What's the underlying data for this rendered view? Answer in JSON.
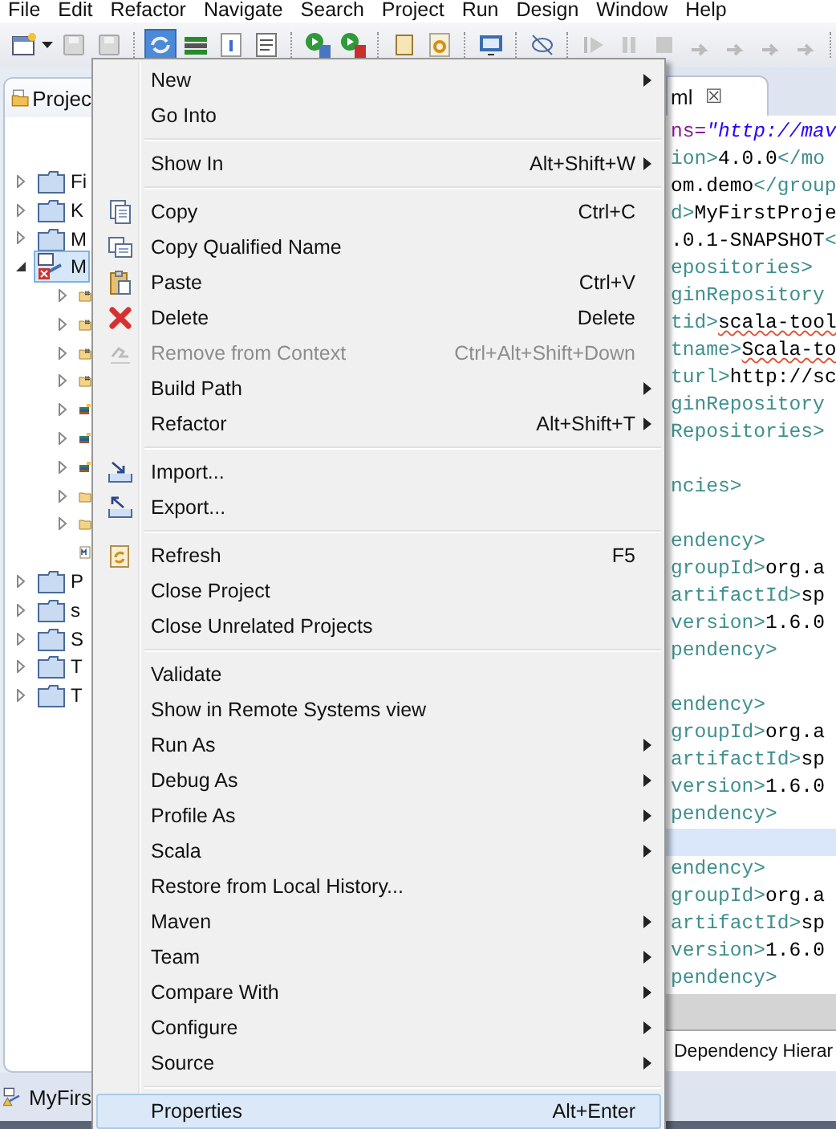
{
  "menubar": [
    "File",
    "Edit",
    "Refactor",
    "Navigate",
    "Search",
    "Project",
    "Run",
    "Design",
    "Window",
    "Help"
  ],
  "explorer": {
    "tab": "Projec",
    "items": [
      {
        "label": "Fi",
        "kind": "project",
        "expanded": false,
        "selected": false
      },
      {
        "label": "K",
        "kind": "project",
        "expanded": false,
        "selected": false
      },
      {
        "label": "M",
        "kind": "project",
        "expanded": false,
        "selected": false
      },
      {
        "label": "M",
        "kind": "maven",
        "expanded": true,
        "selected": true,
        "children": [
          {
            "kind": "package",
            "expanded": false
          },
          {
            "kind": "package",
            "expanded": false
          },
          {
            "kind": "package",
            "expanded": false
          },
          {
            "kind": "package",
            "expanded": false
          },
          {
            "kind": "library",
            "expanded": false
          },
          {
            "kind": "library",
            "expanded": false
          },
          {
            "kind": "library",
            "expanded": false
          },
          {
            "kind": "folder",
            "expanded": false
          },
          {
            "kind": "folder",
            "expanded": false
          },
          {
            "kind": "file"
          }
        ]
      },
      {
        "label": "P",
        "kind": "project",
        "expanded": false,
        "selected": false
      },
      {
        "label": "s",
        "kind": "project",
        "expanded": false,
        "selected": false
      },
      {
        "label": "S",
        "kind": "project",
        "expanded": false,
        "selected": false
      },
      {
        "label": "T",
        "kind": "project",
        "expanded": false,
        "selected": false
      },
      {
        "label": "T",
        "kind": "project",
        "expanded": false,
        "selected": false
      }
    ],
    "status": "MyFirs"
  },
  "editor": {
    "tab": "ml",
    "close": "☒",
    "lines": [
      {
        "kind": "code",
        "current": false,
        "segments": [
          {
            "kind": "attr",
            "text": "ns="
          },
          {
            "kind": "string",
            "text": "\"http://mav"
          }
        ]
      },
      {
        "kind": "code",
        "current": false,
        "segments": [
          {
            "kind": "tag",
            "text": "ion>"
          },
          {
            "kind": "text",
            "text": "4.0.0"
          },
          {
            "kind": "tag",
            "text": "</mo"
          }
        ]
      },
      {
        "kind": "code",
        "current": false,
        "segments": [
          {
            "kind": "text",
            "text": "om.demo"
          },
          {
            "kind": "tag",
            "text": "</group"
          }
        ]
      },
      {
        "kind": "code",
        "current": false,
        "segments": [
          {
            "kind": "tag",
            "text": "d>"
          },
          {
            "kind": "text",
            "text": "MyFirstProje"
          }
        ]
      },
      {
        "kind": "code",
        "current": false,
        "segments": [
          {
            "kind": "text",
            "text": ".0.1-SNAPSHOT"
          },
          {
            "kind": "tag",
            "text": "<"
          }
        ]
      },
      {
        "kind": "code",
        "current": false,
        "segments": [
          {
            "kind": "tag",
            "text": "epositories>"
          }
        ]
      },
      {
        "kind": "code",
        "current": false,
        "segments": [
          {
            "kind": "tag",
            "text": "ginRepository"
          }
        ]
      },
      {
        "kind": "code",
        "current": false,
        "segments": [
          {
            "kind": "tag",
            "text": "tid>"
          },
          {
            "kind": "text",
            "text": "scala-tool",
            "misspelled": true
          }
        ]
      },
      {
        "kind": "code",
        "current": false,
        "segments": [
          {
            "kind": "tag",
            "text": "tname>"
          },
          {
            "kind": "text",
            "text": "Scala-to",
            "misspelled": true
          }
        ]
      },
      {
        "kind": "code",
        "current": false,
        "segments": [
          {
            "kind": "tag",
            "text": "turl>"
          },
          {
            "kind": "text",
            "text": "http://sc"
          }
        ]
      },
      {
        "kind": "code",
        "current": false,
        "segments": [
          {
            "kind": "tag",
            "text": "ginRepository"
          }
        ]
      },
      {
        "kind": "code",
        "current": false,
        "segments": [
          {
            "kind": "tag",
            "text": "Repositories>"
          }
        ]
      },
      {
        "kind": "blank",
        "current": false
      },
      {
        "kind": "code",
        "current": false,
        "segments": [
          {
            "kind": "tag",
            "text": "ncies>"
          }
        ]
      },
      {
        "kind": "blank",
        "current": false
      },
      {
        "kind": "code",
        "current": false,
        "segments": [
          {
            "kind": "tag",
            "text": "endency>"
          }
        ]
      },
      {
        "kind": "code",
        "current": false,
        "segments": [
          {
            "kind": "tag",
            "text": "groupId>"
          },
          {
            "kind": "text",
            "text": "org.a"
          }
        ]
      },
      {
        "kind": "code",
        "current": false,
        "segments": [
          {
            "kind": "tag",
            "text": "artifactId>"
          },
          {
            "kind": "text",
            "text": "sp"
          }
        ]
      },
      {
        "kind": "code",
        "current": false,
        "segments": [
          {
            "kind": "tag",
            "text": "version>"
          },
          {
            "kind": "text",
            "text": "1.6.0"
          }
        ]
      },
      {
        "kind": "code",
        "current": false,
        "segments": [
          {
            "kind": "tag",
            "text": "pendency>"
          }
        ]
      },
      {
        "kind": "blank",
        "current": false
      },
      {
        "kind": "code",
        "current": false,
        "segments": [
          {
            "kind": "tag",
            "text": "endency>"
          }
        ]
      },
      {
        "kind": "code",
        "current": false,
        "segments": [
          {
            "kind": "tag",
            "text": "groupId>"
          },
          {
            "kind": "text",
            "text": "org.a"
          }
        ]
      },
      {
        "kind": "code",
        "current": false,
        "segments": [
          {
            "kind": "tag",
            "text": "artifactId>"
          },
          {
            "kind": "text",
            "text": "sp"
          }
        ]
      },
      {
        "kind": "code",
        "current": false,
        "segments": [
          {
            "kind": "tag",
            "text": "version>"
          },
          {
            "kind": "text",
            "text": "1.6.0"
          }
        ]
      },
      {
        "kind": "code",
        "current": false,
        "segments": [
          {
            "kind": "tag",
            "text": "pendency>"
          }
        ]
      },
      {
        "kind": "blank",
        "current": true
      },
      {
        "kind": "code",
        "current": false,
        "segments": [
          {
            "kind": "tag",
            "text": "endency>"
          }
        ]
      },
      {
        "kind": "code",
        "current": false,
        "segments": [
          {
            "kind": "tag",
            "text": "groupId>"
          },
          {
            "kind": "text",
            "text": "org.a"
          }
        ]
      },
      {
        "kind": "code",
        "current": false,
        "segments": [
          {
            "kind": "tag",
            "text": "artifactId>"
          },
          {
            "kind": "text",
            "text": "sp"
          }
        ]
      },
      {
        "kind": "code",
        "current": false,
        "segments": [
          {
            "kind": "tag",
            "text": "version>"
          },
          {
            "kind": "text",
            "text": "1.6.0"
          }
        ]
      },
      {
        "kind": "code",
        "current": false,
        "segments": [
          {
            "kind": "tag",
            "text": "pendency>"
          }
        ]
      }
    ],
    "bottom_tab": "Dependency Hierar"
  },
  "context_menu": [
    {
      "kind": "item",
      "label": "New",
      "submenu": true,
      "disabled": false,
      "selected": false
    },
    {
      "kind": "item",
      "label": "Go Into",
      "submenu": false,
      "disabled": false,
      "selected": false
    },
    {
      "kind": "separator"
    },
    {
      "kind": "item",
      "label": "Show In",
      "shortcut": "Alt+Shift+W",
      "submenu": true,
      "disabled": false,
      "selected": false
    },
    {
      "kind": "separator"
    },
    {
      "kind": "item",
      "label": "Copy",
      "shortcut": "Ctrl+C",
      "submenu": false,
      "disabled": false,
      "selected": false
    },
    {
      "kind": "item",
      "label": "Copy Qualified Name",
      "submenu": false,
      "disabled": false,
      "selected": false
    },
    {
      "kind": "item",
      "label": "Paste",
      "shortcut": "Ctrl+V",
      "submenu": false,
      "disabled": false,
      "selected": false
    },
    {
      "kind": "item",
      "label": "Delete",
      "shortcut": "Delete",
      "submenu": false,
      "disabled": false,
      "selected": false
    },
    {
      "kind": "item",
      "label": "Remove from Context",
      "shortcut": "Ctrl+Alt+Shift+Down",
      "submenu": false,
      "disabled": true,
      "selected": false
    },
    {
      "kind": "item",
      "label": "Build Path",
      "submenu": true,
      "disabled": false,
      "selected": false
    },
    {
      "kind": "item",
      "label": "Refactor",
      "shortcut": "Alt+Shift+T",
      "submenu": true,
      "disabled": false,
      "selected": false
    },
    {
      "kind": "separator"
    },
    {
      "kind": "item",
      "label": "Import...",
      "submenu": false,
      "disabled": false,
      "selected": false
    },
    {
      "kind": "item",
      "label": "Export...",
      "submenu": false,
      "disabled": false,
      "selected": false
    },
    {
      "kind": "separator"
    },
    {
      "kind": "item",
      "label": "Refresh",
      "shortcut": "F5",
      "submenu": false,
      "disabled": false,
      "selected": false
    },
    {
      "kind": "item",
      "label": "Close Project",
      "submenu": false,
      "disabled": false,
      "selected": false
    },
    {
      "kind": "item",
      "label": "Close Unrelated Projects",
      "submenu": false,
      "disabled": false,
      "selected": false
    },
    {
      "kind": "separator"
    },
    {
      "kind": "item",
      "label": "Validate",
      "submenu": false,
      "disabled": false,
      "selected": false
    },
    {
      "kind": "item",
      "label": "Show in Remote Systems view",
      "submenu": false,
      "disabled": false,
      "selected": false
    },
    {
      "kind": "item",
      "label": "Run As",
      "submenu": true,
      "disabled": false,
      "selected": false
    },
    {
      "kind": "item",
      "label": "Debug As",
      "submenu": true,
      "disabled": false,
      "selected": false
    },
    {
      "kind": "item",
      "label": "Profile As",
      "submenu": true,
      "disabled": false,
      "selected": false
    },
    {
      "kind": "item",
      "label": "Scala",
      "submenu": true,
      "disabled": false,
      "selected": false
    },
    {
      "kind": "item",
      "label": "Restore from Local History...",
      "submenu": false,
      "disabled": false,
      "selected": false
    },
    {
      "kind": "item",
      "label": "Maven",
      "submenu": true,
      "disabled": false,
      "selected": false
    },
    {
      "kind": "item",
      "label": "Team",
      "submenu": true,
      "disabled": false,
      "selected": false
    },
    {
      "kind": "item",
      "label": "Compare With",
      "submenu": true,
      "disabled": false,
      "selected": false
    },
    {
      "kind": "item",
      "label": "Configure",
      "submenu": true,
      "disabled": false,
      "selected": false
    },
    {
      "kind": "item",
      "label": "Source",
      "submenu": true,
      "disabled": false,
      "selected": false
    },
    {
      "kind": "separator"
    },
    {
      "kind": "item",
      "label": "Properties",
      "shortcut": "Alt+Enter",
      "submenu": false,
      "disabled": false,
      "selected": true
    }
  ]
}
